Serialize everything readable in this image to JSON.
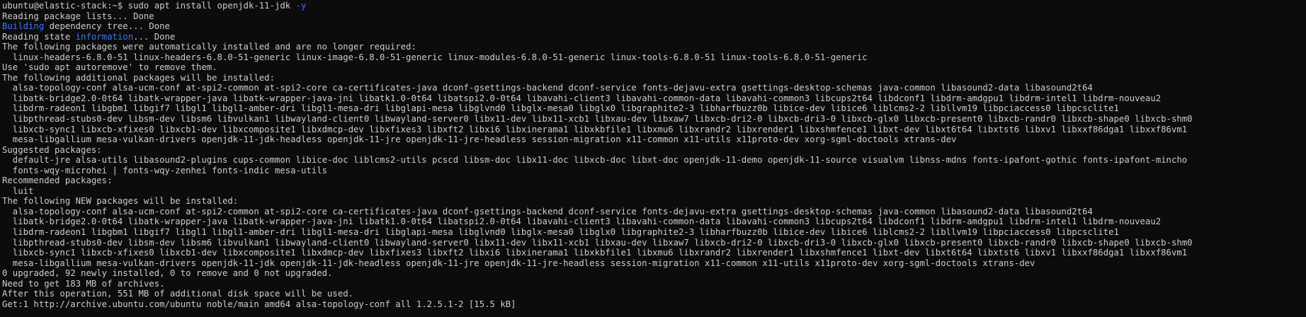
{
  "theme": {
    "background": "#0c0c0c",
    "foreground": "#cccccc",
    "accent": "#3b78ff"
  },
  "terminal": {
    "lines": [
      [
        {
          "t": "ubuntu@elastic-stack:~$ sudo apt install openjdk-11-jdk "
        },
        {
          "t": "-y",
          "c": "blue"
        }
      ],
      [
        {
          "t": "Reading package lists... Done"
        }
      ],
      [
        {
          "t": "Building",
          "c": "blue"
        },
        {
          "t": " dependency tree... Done"
        }
      ],
      [
        {
          "t": "Reading state "
        },
        {
          "t": "information",
          "c": "blue"
        },
        {
          "t": "... Done"
        }
      ],
      [
        {
          "t": "The following packages were automatically installed and are no longer required:"
        }
      ],
      [
        {
          "t": "  linux-headers-6.8.0-51 linux-headers-6.8.0-51-generic linux-image-6.8.0-51-generic linux-modules-6.8.0-51-generic linux-tools-6.8.0-51 linux-tools-6.8.0-51-generic"
        }
      ],
      [
        {
          "t": "Use 'sudo apt autoremove' to remove them."
        }
      ],
      [
        {
          "t": "The following additional packages will be installed:"
        }
      ],
      [
        {
          "t": "  alsa-topology-conf alsa-ucm-conf at-spi2-common at-spi2-core ca-certificates-java dconf-gsettings-backend dconf-service fonts-dejavu-extra gsettings-desktop-schemas java-common libasound2-data libasound2t64"
        }
      ],
      [
        {
          "t": "  libatk-bridge2.0-0t64 libatk-wrapper-java libatk-wrapper-java-jni libatk1.0-0t64 libatspi2.0-0t64 libavahi-client3 libavahi-common-data libavahi-common3 libcups2t64 libdconf1 libdrm-amdgpu1 libdrm-intel1 libdrm-nouveau2"
        }
      ],
      [
        {
          "t": "  libdrm-radeon1 libgbm1 libgif7 libgl1 libgl1-amber-dri libgl1-mesa-dri libglapi-mesa libglvnd0 libglx-mesa0 libglx0 libgraphite2-3 libharfbuzz0b libice-dev libice6 liblcms2-2 libllvm19 libpciaccess0 libpcsclite1"
        }
      ],
      [
        {
          "t": "  libpthread-stubs0-dev libsm-dev libsm6 libvulkan1 libwayland-client0 libwayland-server0 libx11-dev libx11-xcb1 libxau-dev libxaw7 libxcb-dri2-0 libxcb-dri3-0 libxcb-glx0 libxcb-present0 libxcb-randr0 libxcb-shape0 libxcb-shm0"
        }
      ],
      [
        {
          "t": "  libxcb-sync1 libxcb-xfixes0 libxcb1-dev libxcomposite1 libxdmcp-dev libxfixes3 libxft2 libxi6 libxinerama1 libxkbfile1 libxmu6 libxrandr2 libxrender1 libxshmfence1 libxt-dev libxt6t64 libxtst6 libxv1 libxxf86dga1 libxxf86vm1"
        }
      ],
      [
        {
          "t": "  mesa-libgallium mesa-vulkan-drivers openjdk-11-jdk-headless openjdk-11-jre openjdk-11-jre-headless session-migration x11-common x11-utils x11proto-dev xorg-sgml-doctools xtrans-dev"
        }
      ],
      [
        {
          "t": "Suggested packages:"
        }
      ],
      [
        {
          "t": "  default-jre alsa-utils libasound2-plugins cups-common libice-doc liblcms2-utils pcscd libsm-doc libx11-doc libxcb-doc libxt-doc openjdk-11-demo openjdk-11-source visualvm libnss-mdns fonts-ipafont-gothic fonts-ipafont-mincho"
        }
      ],
      [
        {
          "t": "  fonts-wqy-microhei | fonts-wqy-zenhei fonts-indic mesa-utils"
        }
      ],
      [
        {
          "t": "Recommended packages:"
        }
      ],
      [
        {
          "t": "  luit"
        }
      ],
      [
        {
          "t": "The following NEW packages will be installed:"
        }
      ],
      [
        {
          "t": "  alsa-topology-conf alsa-ucm-conf at-spi2-common at-spi2-core ca-certificates-java dconf-gsettings-backend dconf-service fonts-dejavu-extra gsettings-desktop-schemas java-common libasound2-data libasound2t64"
        }
      ],
      [
        {
          "t": "  libatk-bridge2.0-0t64 libatk-wrapper-java libatk-wrapper-java-jni libatk1.0-0t64 libatspi2.0-0t64 libavahi-client3 libavahi-common-data libavahi-common3 libcups2t64 libdconf1 libdrm-amdgpu1 libdrm-intel1 libdrm-nouveau2"
        }
      ],
      [
        {
          "t": "  libdrm-radeon1 libgbm1 libgif7 libgl1 libgl1-amber-dri libgl1-mesa-dri libglapi-mesa libglvnd0 libglx-mesa0 libglx0 libgraphite2-3 libharfbuzz0b libice-dev libice6 liblcms2-2 libllvm19 libpciaccess0 libpcsclite1"
        }
      ],
      [
        {
          "t": "  libpthread-stubs0-dev libsm-dev libsm6 libvulkan1 libwayland-client0 libwayland-server0 libx11-dev libx11-xcb1 libxau-dev libxaw7 libxcb-dri2-0 libxcb-dri3-0 libxcb-glx0 libxcb-present0 libxcb-randr0 libxcb-shape0 libxcb-shm0"
        }
      ],
      [
        {
          "t": "  libxcb-sync1 libxcb-xfixes0 libxcb1-dev libxcomposite1 libxdmcp-dev libxfixes3 libxft2 libxi6 libxinerama1 libxkbfile1 libxmu6 libxrandr2 libxrender1 libxshmfence1 libxt-dev libxt6t64 libxtst6 libxv1 libxxf86dga1 libxxf86vm1"
        }
      ],
      [
        {
          "t": "  mesa-libgallium mesa-vulkan-drivers openjdk-11-jdk openjdk-11-jdk-headless openjdk-11-jre openjdk-11-jre-headless session-migration x11-common x11-utils x11proto-dev xorg-sgml-doctools xtrans-dev"
        }
      ],
      [
        {
          "t": "0 upgraded, 92 newly installed, 0 to remove and 0 not upgraded."
        }
      ],
      [
        {
          "t": "Need to get 183 MB of archives."
        }
      ],
      [
        {
          "t": "After this operation, 551 MB of additional disk space will be used."
        }
      ],
      [
        {
          "t": "Get:1 http://archive.ubuntu.com/ubuntu noble/main amd64 alsa-topology-conf all 1.2.5.1-2 [15.5 kB]"
        }
      ]
    ]
  }
}
